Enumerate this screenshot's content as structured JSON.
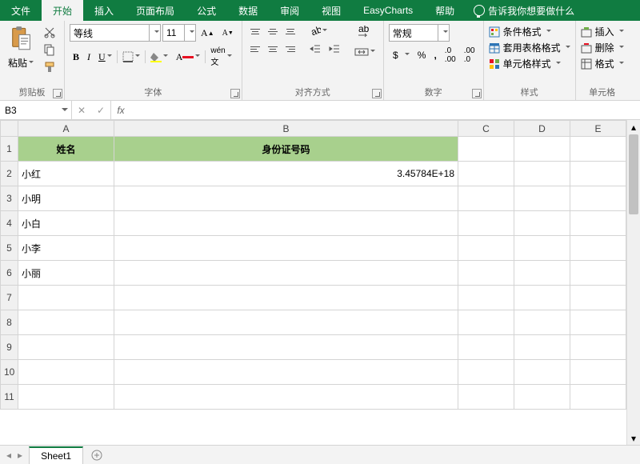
{
  "menu": {
    "file": "文件",
    "home": "开始",
    "insert": "插入",
    "layout": "页面布局",
    "formulas": "公式",
    "data": "数据",
    "review": "审阅",
    "view": "视图",
    "easycharts": "EasyCharts",
    "help": "帮助",
    "tellme": "告诉我你想要做什么"
  },
  "ribbon": {
    "clipboard": {
      "paste": "粘贴",
      "label": "剪贴板"
    },
    "font": {
      "name": "等线",
      "size": "11",
      "label": "字体"
    },
    "align": {
      "label": "对齐方式"
    },
    "number": {
      "format": "常规",
      "label": "数字"
    },
    "styles": {
      "cond": "条件格式",
      "table": "套用表格格式",
      "cell": "单元格样式",
      "label": "样式"
    },
    "cells": {
      "insert": "插入",
      "delete": "删除",
      "format": "格式",
      "label": "单元格"
    }
  },
  "namebox": "B3",
  "formula": "",
  "cols": [
    "A",
    "B",
    "C",
    "D",
    "E"
  ],
  "rows": [
    {
      "n": "1",
      "a": "姓名",
      "b": "身份证号码",
      "hdr": true
    },
    {
      "n": "2",
      "a": "小红",
      "b": "3.45784E+18",
      "num": true
    },
    {
      "n": "3",
      "a": "小明",
      "b": ""
    },
    {
      "n": "4",
      "a": "小白",
      "b": ""
    },
    {
      "n": "5",
      "a": "小李",
      "b": ""
    },
    {
      "n": "6",
      "a": "小丽",
      "b": ""
    },
    {
      "n": "7",
      "a": "",
      "b": ""
    },
    {
      "n": "8",
      "a": "",
      "b": ""
    },
    {
      "n": "9",
      "a": "",
      "b": ""
    },
    {
      "n": "10",
      "a": "",
      "b": ""
    },
    {
      "n": "11",
      "a": "",
      "b": ""
    }
  ],
  "sheet": "Sheet1"
}
